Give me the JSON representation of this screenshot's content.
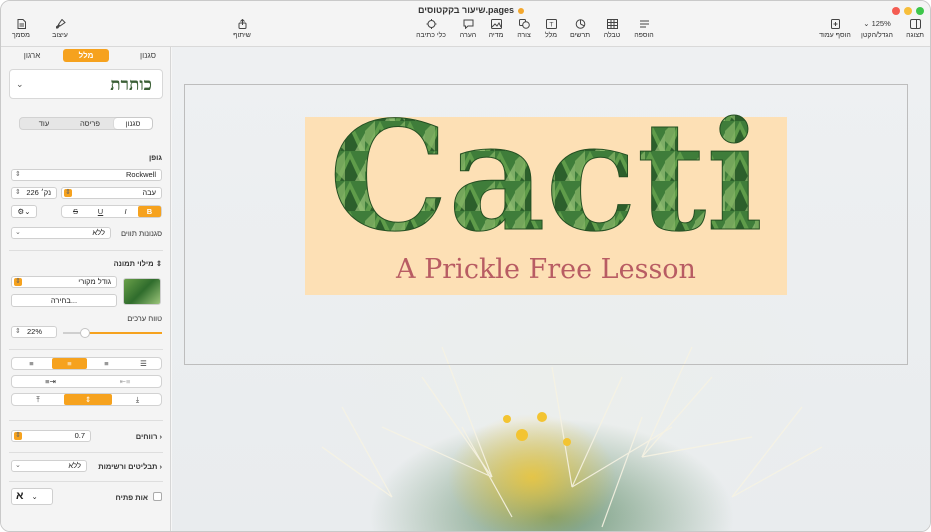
{
  "window": {
    "title": "שיעור בקקטוסים.pages",
    "traffic_colors": [
      "#f45c52",
      "#f7be3a",
      "#3dc64a"
    ]
  },
  "toolbar": {
    "items": [
      {
        "key": "view",
        "label": "תצוגה",
        "icon": "sidebar-icon"
      },
      {
        "key": "zoom",
        "label": "הגדל/הקטן",
        "value": "125%",
        "icon": "chevron-down-icon"
      },
      {
        "key": "add_page",
        "label": "הוסף עמוד",
        "icon": "add-page-icon"
      },
      {
        "key": "insert",
        "label": "הוספה",
        "icon": "insert-icon"
      },
      {
        "key": "table",
        "label": "טבלה",
        "icon": "table-icon"
      },
      {
        "key": "chart",
        "label": "תרשים",
        "icon": "chart-icon"
      },
      {
        "key": "text",
        "label": "מלל",
        "icon": "text-icon"
      },
      {
        "key": "shape",
        "label": "צורה",
        "icon": "shape-icon"
      },
      {
        "key": "media",
        "label": "מדיה",
        "icon": "media-icon"
      },
      {
        "key": "comment",
        "label": "הערה",
        "icon": "comment-icon"
      },
      {
        "key": "writing_tools",
        "label": "כלי כתיבה",
        "icon": "writing-tools-icon"
      },
      {
        "key": "share",
        "label": "שיתוף",
        "icon": "share-icon"
      },
      {
        "key": "format",
        "label": "עיצוב",
        "icon": "paintbrush-icon"
      },
      {
        "key": "document",
        "label": "מסמך",
        "icon": "document-icon"
      }
    ]
  },
  "sidebar": {
    "tabs": [
      "סגנון",
      "מלל",
      "ארגון"
    ],
    "selected_tab": "מלל",
    "paragraph_style": "כותרת",
    "sub_tabs": [
      "סגנון",
      "פריסה",
      "עוד"
    ],
    "font_section_label": "גופן",
    "font_name": "Rockwell",
    "font_weight": "עבה",
    "font_size": "226 נק׳",
    "style_buttons": [
      "B",
      "I",
      "U",
      "S"
    ],
    "char_styles_label": "סגנונות תווים",
    "char_styles_value": "ללא",
    "image_fill_label": "מילוי תמונה",
    "image_fill_value": "גודל מקורי",
    "choose_button": "בחירה...",
    "tonal_range_label": "טווח ערכים",
    "tonal_range_value": "22%",
    "tonal_range_fraction": 0.22,
    "spacing_label": "רווחים",
    "spacing_value": "0.7",
    "bullets_label": "תבליטים ורשימות",
    "bullets_value": "ללא",
    "drop_cap_label": "אות פתיח",
    "drop_cap_glyph": "א"
  },
  "document": {
    "title_text": "Cacti",
    "subtitle_text": "A Prickle Free Lesson",
    "title_box_color": "#fde0b5",
    "subtitle_color": "#b85c63",
    "accent": "#f6a21e"
  }
}
